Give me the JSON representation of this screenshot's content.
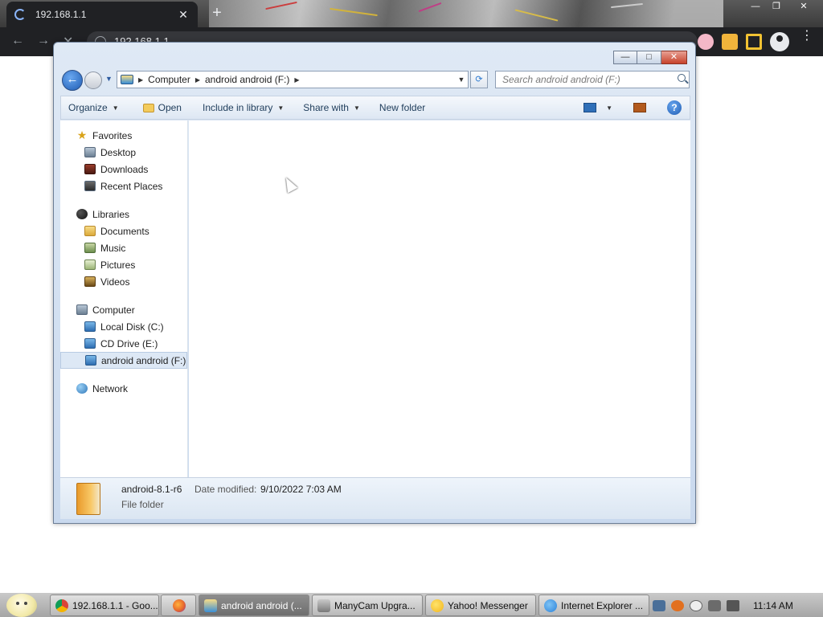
{
  "browser": {
    "tab_title": "192.168.1.1",
    "tab_close": "✕",
    "new_tab": "+",
    "address": "192.168.1.1",
    "back": "←",
    "forward": "→",
    "stop": "✕",
    "window_min": "—",
    "window_max": "❐",
    "window_close": "✕",
    "menu": "⋮"
  },
  "explorer": {
    "caption_min": "—",
    "caption_max": "□",
    "caption_close": "✕",
    "back_glyph": "←",
    "breadcrumb": [
      "Computer",
      "android android (F:)"
    ],
    "search_placeholder": "Search android android (F:)",
    "toolbar": {
      "organize": "Organize",
      "open": "Open",
      "include_in_library": "Include in library",
      "share_with": "Share with",
      "new_folder": "New folder",
      "help": "?"
    },
    "nav": {
      "favorites": {
        "label": "Favorites",
        "items": [
          "Desktop",
          "Downloads",
          "Recent Places"
        ]
      },
      "libraries": {
        "label": "Libraries",
        "items": [
          "Documents",
          "Music",
          "Pictures",
          "Videos"
        ]
      },
      "computer": {
        "label": "Computer",
        "items": [
          "Local Disk (C:)",
          "CD Drive (E:)",
          "android android (F:)"
        ],
        "selected": "android android (F:)"
      },
      "network": {
        "label": "Network"
      }
    },
    "details": {
      "name": "android-8.1-r6",
      "date_label": "Date modified:",
      "date_value": "9/10/2022 7:03 AM",
      "type": "File folder"
    }
  },
  "taskbar": {
    "buttons": [
      {
        "label": "192.168.1.1 - Goo...",
        "icon": "chrome-icon",
        "color": "#3b7ddd"
      },
      {
        "label": "",
        "icon": "firefox-icon",
        "color": "#e8692b"
      },
      {
        "label": "android android (...",
        "icon": "explorer-icon",
        "color": "#3a8fd6",
        "active": true
      },
      {
        "label": "ManyCam Upgra...",
        "icon": "manycam-icon",
        "color": "#8c8c8c"
      },
      {
        "label": "Yahoo! Messenger",
        "icon": "yahoo-messenger-icon",
        "color": "#f2c21b"
      },
      {
        "label": "Internet Explorer ...",
        "icon": "ie-icon",
        "color": "#2b82d9"
      }
    ],
    "clock": "11:14 AM"
  }
}
